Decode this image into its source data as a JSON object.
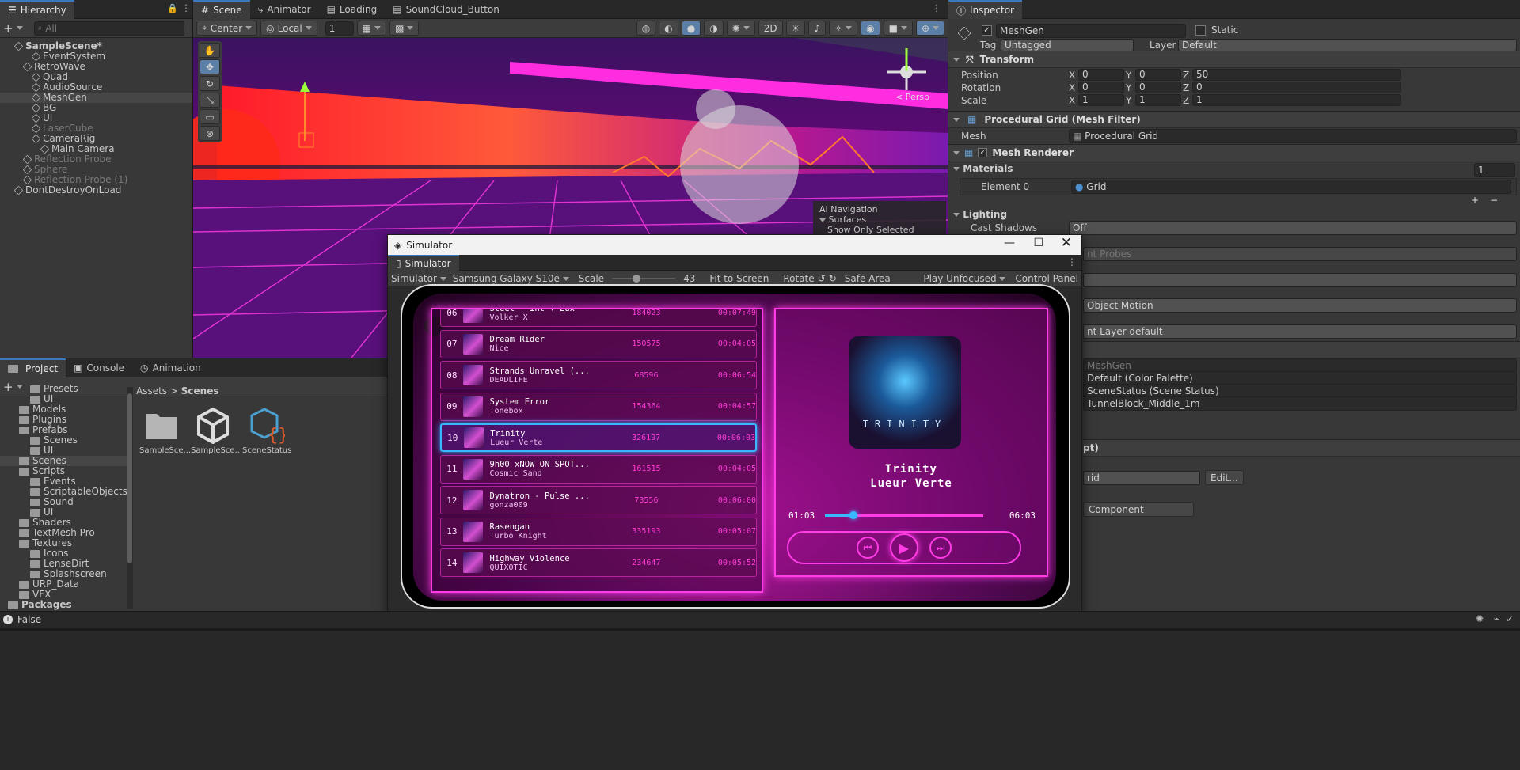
{
  "hierarchy": {
    "tab": "Hierarchy",
    "search_placeholder": "All",
    "items": [
      {
        "label": "SampleScene*",
        "indent": 0,
        "type": "scene",
        "bold": true
      },
      {
        "label": "EventSystem",
        "indent": 2,
        "type": "cube"
      },
      {
        "label": "RetroWave",
        "indent": 1,
        "type": "cube",
        "expanded": true
      },
      {
        "label": "Quad",
        "indent": 2,
        "type": "cube"
      },
      {
        "label": "AudioSource",
        "indent": 2,
        "type": "cube"
      },
      {
        "label": "MeshGen",
        "indent": 2,
        "type": "cube",
        "selected": true
      },
      {
        "label": "BG",
        "indent": 2,
        "type": "cube"
      },
      {
        "label": "UI",
        "indent": 2,
        "type": "cube"
      },
      {
        "label": "LaserCube",
        "indent": 2,
        "type": "cube",
        "dim": true
      },
      {
        "label": "CameraRig",
        "indent": 2,
        "type": "cube"
      },
      {
        "label": "Main Camera",
        "indent": 3,
        "type": "cube"
      },
      {
        "label": "Reflection Probe",
        "indent": 1,
        "type": "cube",
        "dim": true
      },
      {
        "label": "Sphere",
        "indent": 1,
        "type": "cube",
        "dim": true
      },
      {
        "label": "Reflection Probe (1)",
        "indent": 1,
        "type": "cube",
        "dim": true
      },
      {
        "label": "DontDestroyOnLoad",
        "indent": 0,
        "type": "scene"
      }
    ]
  },
  "scene_tabs": [
    "Scene",
    "Animator",
    "Loading",
    "SoundCloud_Button"
  ],
  "scene_toolbar": {
    "pivot": "Center",
    "space": "Local",
    "snap": "1",
    "mode2d": "2D",
    "persp": "< Persp"
  },
  "overlay_menu": {
    "title": "AI Navigation",
    "item1": "Surfaces",
    "item2": "Show Only Selected"
  },
  "project": {
    "tabs": [
      "Project",
      "Console",
      "Animation"
    ],
    "breadcrumb": [
      "Assets",
      "Scenes"
    ],
    "tree": [
      {
        "label": "Presets",
        "indent": 2
      },
      {
        "label": "UI",
        "indent": 2
      },
      {
        "label": "Models",
        "indent": 1
      },
      {
        "label": "Plugins",
        "indent": 1
      },
      {
        "label": "Prefabs",
        "indent": 1
      },
      {
        "label": "Scenes",
        "indent": 2
      },
      {
        "label": "UI",
        "indent": 2
      },
      {
        "label": "Scenes",
        "indent": 1,
        "selected": true
      },
      {
        "label": "Scripts",
        "indent": 1
      },
      {
        "label": "Events",
        "indent": 2
      },
      {
        "label": "ScriptableObjects",
        "indent": 2
      },
      {
        "label": "Sound",
        "indent": 2
      },
      {
        "label": "UI",
        "indent": 2
      },
      {
        "label": "Shaders",
        "indent": 1
      },
      {
        "label": "TextMesh Pro",
        "indent": 1
      },
      {
        "label": "Textures",
        "indent": 1
      },
      {
        "label": "Icons",
        "indent": 2
      },
      {
        "label": "LenseDirt",
        "indent": 2
      },
      {
        "label": "Splashscreen",
        "indent": 2
      },
      {
        "label": "URP_Data",
        "indent": 1
      },
      {
        "label": "VFX",
        "indent": 1
      },
      {
        "label": "Packages",
        "indent": 0,
        "bold": true
      }
    ],
    "assets": [
      "SampleSce...",
      "SampleSce...",
      "SceneStatus"
    ]
  },
  "inspector": {
    "tab": "Inspector",
    "object_name": "MeshGen",
    "static_label": "Static",
    "tag_label": "Tag",
    "tag_value": "Untagged",
    "layer_label": "Layer",
    "layer_value": "Default",
    "transform": {
      "title": "Transform",
      "position_label": "Position",
      "position": [
        "0",
        "0",
        "50"
      ],
      "rotation_label": "Rotation",
      "rotation": [
        "0",
        "0",
        "0"
      ],
      "scale_label": "Scale",
      "scale": [
        "1",
        "1",
        "1"
      ]
    },
    "mesh_filter": {
      "title": "Procedural Grid (Mesh Filter)",
      "mesh_label": "Mesh",
      "mesh_value": "Procedural Grid"
    },
    "mesh_renderer": {
      "title": "Mesh Renderer",
      "materials_label": "Materials",
      "materials_count": "1",
      "element_label": "Element 0",
      "element_value": "Grid"
    },
    "lighting": {
      "title": "Lighting",
      "cast_shadows_label": "Cast Shadows",
      "cast_shadows_value": "Off"
    },
    "partial": {
      "probes": "nt Probes",
      "motion": "Object Motion",
      "layer_default": "nt Layer default",
      "meshgen": "MeshGen",
      "palette": "Default (Color Palette)",
      "status": "SceneStatus (Scene Status)",
      "tunnel": "TunnelBlock_Middle_1m",
      "script": "pt)",
      "grid": "rid",
      "edit": "Edit...",
      "add_component": "Component"
    }
  },
  "simulator": {
    "window_title": "Simulator",
    "tab": "Simulator",
    "toolbar": {
      "mode": "Simulator",
      "device": "Samsung Galaxy S10e",
      "scale_label": "Scale",
      "scale_value": "43",
      "fit": "Fit to Screen",
      "rotate": "Rotate",
      "safe_area": "Safe Area",
      "play": "Play Unfocused",
      "control": "Control Panel"
    },
    "tracks": [
      {
        "num": "06",
        "title": "Steel — Int + Lux",
        "artist": "Volker X",
        "plays": "184023",
        "dur": "00:07:49"
      },
      {
        "num": "07",
        "title": "Dream Rider",
        "artist": "Nice",
        "plays": "150575",
        "dur": "00:04:05"
      },
      {
        "num": "08",
        "title": "Strands Unravel (...",
        "artist": "DEADLIFE",
        "plays": "68596",
        "dur": "00:06:54"
      },
      {
        "num": "09",
        "title": "System Error",
        "artist": "Tonebox",
        "plays": "154364",
        "dur": "00:04:57"
      },
      {
        "num": "10",
        "title": "Trinity",
        "artist": "Lueur Verte",
        "plays": "326197",
        "dur": "00:06:03",
        "active": true
      },
      {
        "num": "11",
        "title": "9h00 xNOW ON SPOT...",
        "artist": "Cosmic Sand",
        "plays": "161515",
        "dur": "00:04:05"
      },
      {
        "num": "12",
        "title": "Dynatron - Pulse ...",
        "artist": "gonza009",
        "plays": "73556",
        "dur": "00:06:00"
      },
      {
        "num": "13",
        "title": "Rasengan",
        "artist": "Turbo Knight",
        "plays": "335193",
        "dur": "00:05:07"
      },
      {
        "num": "14",
        "title": "Highway Violence",
        "artist": "QUIXOTIC",
        "plays": "234647",
        "dur": "00:05:52"
      }
    ],
    "now_playing": {
      "title": "Trinity",
      "artist": "Lueur Verte",
      "elapsed": "01:03",
      "total": "06:03",
      "progress": 0.18,
      "album_text": "TRINITY"
    }
  },
  "status_bar": {
    "text": "False"
  },
  "colors": {
    "accent": "#3a79bb",
    "neon_pink": "#ff3dd8",
    "neon_blue": "#39b8ff"
  }
}
